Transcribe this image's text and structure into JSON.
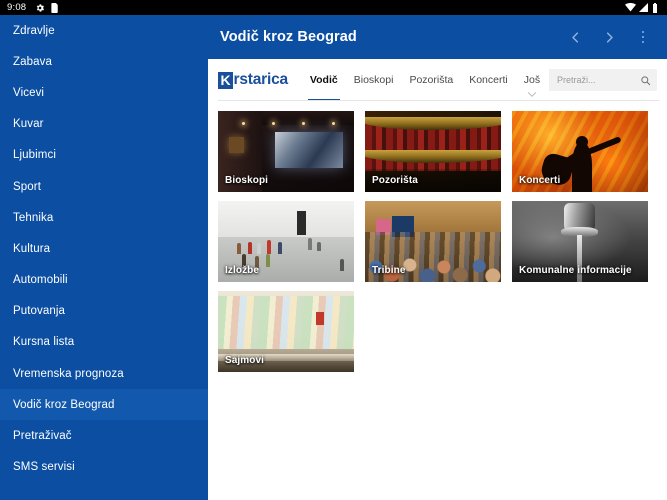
{
  "statusbar": {
    "time": "9:08",
    "left_icons": [
      "gear-icon",
      "sim-card-icon"
    ],
    "right_icons": [
      "wifi-icon",
      "signal-icon",
      "battery-icon"
    ]
  },
  "sidebar": {
    "items": [
      {
        "label": "Zdravlje",
        "active": false
      },
      {
        "label": "Zabava",
        "active": false
      },
      {
        "label": "Vicevi",
        "active": false
      },
      {
        "label": "Kuvar",
        "active": false
      },
      {
        "label": "Ljubimci",
        "active": false
      },
      {
        "label": "Sport",
        "active": false
      },
      {
        "label": "Tehnika",
        "active": false
      },
      {
        "label": "Kultura",
        "active": false
      },
      {
        "label": "Automobili",
        "active": false
      },
      {
        "label": "Putovanja",
        "active": false
      },
      {
        "label": "Kursna lista",
        "active": false
      },
      {
        "label": "Vremenska prognoza",
        "active": false
      },
      {
        "label": "Vodič kroz Beograd",
        "active": true
      },
      {
        "label": "Pretraživač",
        "active": false
      },
      {
        "label": "SMS servisi",
        "active": false
      }
    ]
  },
  "appbar": {
    "title": "Vodič kroz Beograd",
    "back_icon": "chevron-left-icon",
    "forward_icon": "chevron-right-icon",
    "overflow_icon": "kebab-menu-icon"
  },
  "site": {
    "logo": {
      "badge": "K",
      "rest": "rstarica"
    },
    "tabs": [
      {
        "label": "Vodič",
        "active": true,
        "has_chevron": false
      },
      {
        "label": "Bioskopi",
        "active": false,
        "has_chevron": false
      },
      {
        "label": "Pozorišta",
        "active": false,
        "has_chevron": false
      },
      {
        "label": "Koncerti",
        "active": false,
        "has_chevron": false
      },
      {
        "label": "Još",
        "active": false,
        "has_chevron": true
      }
    ],
    "search": {
      "placeholder": "Pretraži...",
      "value": "",
      "icon": "search-icon"
    },
    "cards": [
      {
        "label": "Bioskopi",
        "art": "a-cinema"
      },
      {
        "label": "Pozorišta",
        "art": "a-theatre"
      },
      {
        "label": "Koncerti",
        "art": "a-fire"
      },
      {
        "label": "Izložbe",
        "art": "a-gallery"
      },
      {
        "label": "Tribine",
        "art": "a-crowd"
      },
      {
        "label": "Komunalne informacije",
        "art": "a-tap"
      },
      {
        "label": "Sajmovi",
        "art": "a-books"
      }
    ]
  },
  "colors": {
    "brand_blue": "#0b4ea2",
    "sidebar_active": "#1259ad",
    "accent_link": "#1a4f9c",
    "statusbar": "#000000",
    "page_bg": "#ffffff"
  }
}
